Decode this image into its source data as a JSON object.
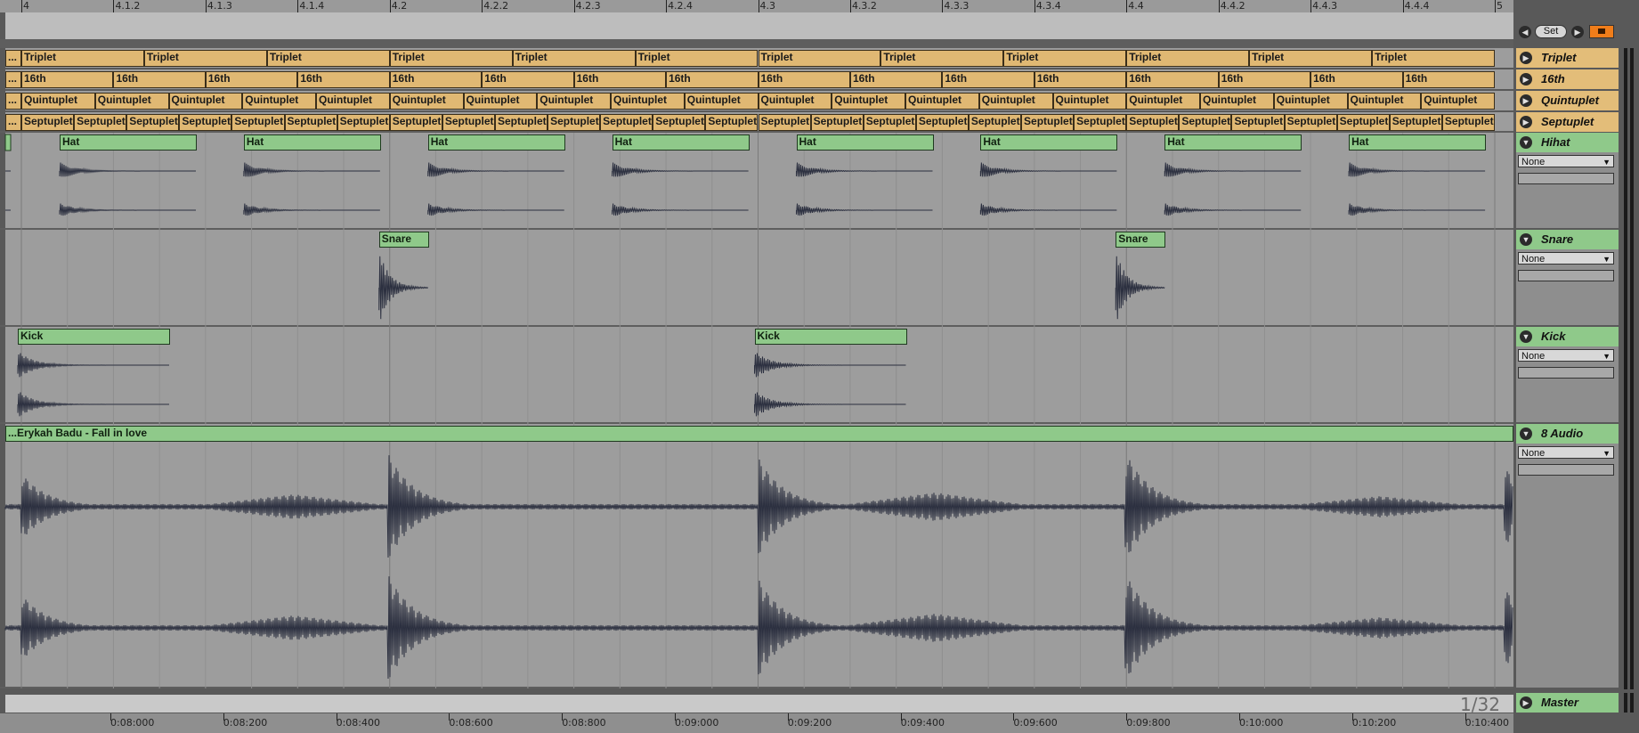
{
  "ruler": {
    "bars": [
      "4",
      "4.1.2",
      "4.1.3",
      "4.1.4",
      "4.2",
      "4.2.2",
      "4.2.3",
      "4.2.4",
      "4.3",
      "4.3.2",
      "4.3.3",
      "4.3.4",
      "4.4",
      "4.4.2",
      "4.4.3",
      "4.4.4",
      "5"
    ],
    "set_label": "Set"
  },
  "tracks": {
    "triplet": {
      "name": "Triplet",
      "clip_label": "Triplet",
      "first_label": "...",
      "count": 12
    },
    "sixteenth": {
      "name": "16th",
      "clip_label": "16th",
      "first_label": "...",
      "count": 16
    },
    "quintuplet": {
      "name": "Quintuplet",
      "clip_label": "Quintuplet",
      "first_label": "...",
      "count": 20
    },
    "septuplet": {
      "name": "Septuplet",
      "clip_label": "Septuplet",
      "first_label": "...",
      "count": 28
    },
    "hihat": {
      "name": "Hihat",
      "clip_label": "Hat",
      "device": "None"
    },
    "snare": {
      "name": "Snare",
      "clip_label": "Snare",
      "device": "None"
    },
    "kick": {
      "name": "Kick",
      "clip_label": "Kick",
      "device": "None"
    },
    "audio": {
      "name": "8 Audio",
      "clip_label": "...Erykah Badu - Fall in love",
      "device": "None"
    },
    "master": {
      "name": "Master"
    }
  },
  "footer": {
    "grid": "1/32",
    "times": [
      "0:08:000",
      "0:08:200",
      "0:08:400",
      "0:08:600",
      "0:08:800",
      "0:09:000",
      "0:09:200",
      "0:09:400",
      "0:09:600",
      "0:09:800",
      "0:10:000",
      "0:10:200",
      "0:10:400"
    ]
  },
  "colors": {
    "grid_clip": "#e0b873",
    "drum_clip": "#8fc98a",
    "waveform": "#2c3040",
    "lane_bg": "#9d9d9d"
  }
}
